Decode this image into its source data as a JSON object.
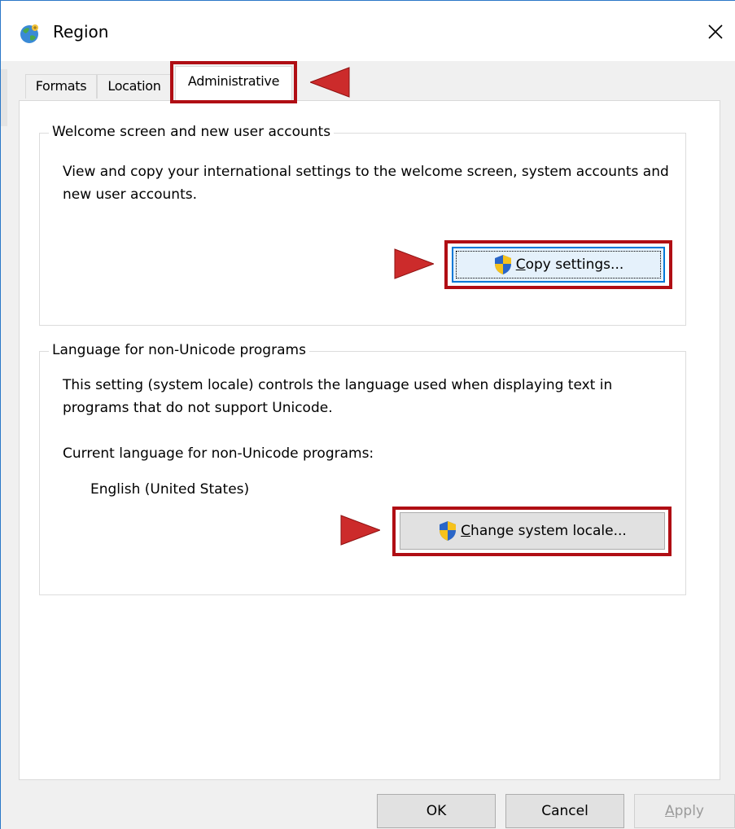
{
  "window": {
    "title": "Region"
  },
  "tabs": [
    {
      "label": "Formats"
    },
    {
      "label": "Location"
    },
    {
      "label": "Administrative"
    }
  ],
  "welcome_group": {
    "title": "Welcome screen and new user accounts",
    "description": "View and copy your international settings to the welcome screen, system accounts and new user accounts.",
    "button": {
      "accel": "C",
      "rest": "opy settings..."
    }
  },
  "language_group": {
    "title": "Language for non-Unicode programs",
    "description": "This setting (system locale) controls the language used when displaying text in programs that do not support Unicode.",
    "current_label": "Current language for non-Unicode programs:",
    "current_value": "English (United States)",
    "button": {
      "accel": "C",
      "rest": "hange system locale..."
    }
  },
  "footer": {
    "ok": "OK",
    "cancel": "Cancel",
    "apply": "Apply",
    "apply_accel": "A",
    "apply_rest": "pply"
  },
  "colors": {
    "highlight": "#b00e14",
    "arrow": "#cc2b2b",
    "focus": "#0078d7"
  },
  "icons": [
    "globe-icon",
    "close-icon",
    "uac-shield-icon"
  ]
}
